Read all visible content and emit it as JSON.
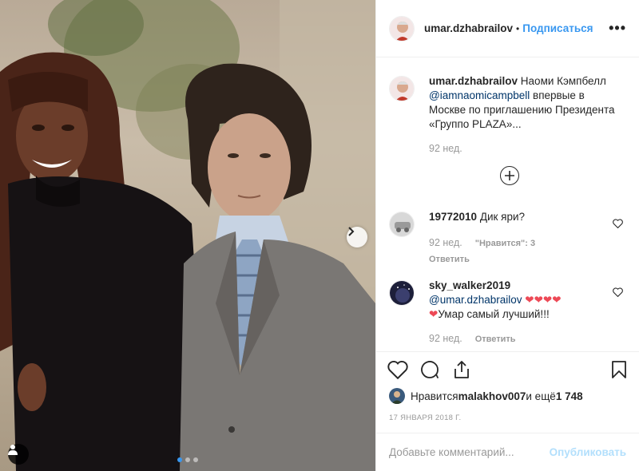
{
  "post": {
    "photo_alt": "",
    "carousel": {
      "count": 3,
      "active": 1
    }
  },
  "header": {
    "username": "umar.dzhabrailov",
    "separator": "•",
    "follow_label": "Подписаться",
    "more_label": "•••"
  },
  "caption": {
    "username": "umar.dzhabrailov",
    "text_before": " Наоми Кэмпбелл ",
    "mention": "@iamnaomicampbell",
    "text_after": " впервые в Москве по приглашению Президента «Группо PLAZA»...",
    "time": "92 нед."
  },
  "comments": [
    {
      "username": "19772010",
      "text": " Дик яри?",
      "time": "92 нед.",
      "likes_label": "\"Нравится\": 3",
      "reply_label": "Ответить"
    },
    {
      "username": "sky_walker2019",
      "mention": "@umar.dzhabrailov",
      "hearts": "❤❤❤❤",
      "heart_prefix": "❤",
      "text": "Умар самый лучший!!!",
      "time": "92 нед.",
      "reply_label": "Ответить"
    }
  ],
  "likes": {
    "prefix": "Нравится ",
    "user": "malakhov007",
    "middle": " и ещё ",
    "count": "1 748"
  },
  "date": "17 ЯНВАРЯ 2018 Г.",
  "comment_box": {
    "placeholder": "Добавьте комментарий...",
    "post_label": "Опубликовать"
  },
  "colors": {
    "accent": "#3897f0",
    "heart": "#ed4956",
    "muted": "#999999"
  }
}
